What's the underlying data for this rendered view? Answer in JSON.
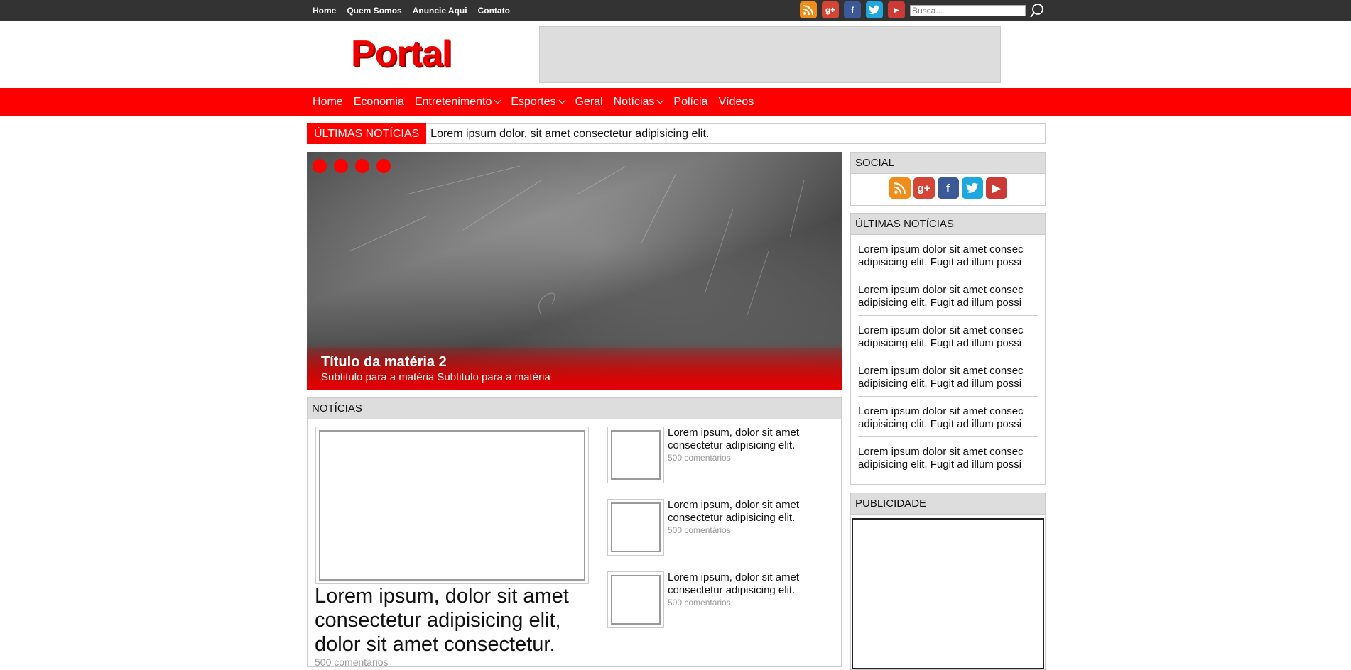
{
  "topnav": [
    "Home",
    "Quem Somos",
    "Anuncie Aqui",
    "Contato"
  ],
  "search": {
    "placeholder": "Busca..."
  },
  "social_icons": [
    "rss-icon",
    "google-plus-icon",
    "facebook-icon",
    "twitter-icon",
    "youtube-icon"
  ],
  "logo": "Portal",
  "mainnav": [
    {
      "label": "Home",
      "has_dropdown": false
    },
    {
      "label": "Economia",
      "has_dropdown": false
    },
    {
      "label": "Entretenimento",
      "has_dropdown": true
    },
    {
      "label": "Esportes",
      "has_dropdown": true
    },
    {
      "label": "Geral",
      "has_dropdown": false
    },
    {
      "label": "Notícias",
      "has_dropdown": true
    },
    {
      "label": "Polícia",
      "has_dropdown": false
    },
    {
      "label": "Vídeos",
      "has_dropdown": false
    }
  ],
  "ticker": {
    "label": "ÚLTIMAS NOTÍCIAS",
    "text": "Lorem ipsum dolor, sit amet consectetur adipisicing elit."
  },
  "slider": {
    "title": "Título da matéria 2",
    "subtitle": "Subtitulo para a matéria Subtitulo para a matéria",
    "dot_count": 4
  },
  "news": {
    "heading": "NOTÍCIAS",
    "featured": {
      "title": "Lorem ipsum, dolor sit amet consectetur adipisicing elit, dolor sit amet consectetur.",
      "comments": "500 comentários"
    },
    "items": [
      {
        "title": "Lorem ipsum, dolor sit amet consectetur adipisicing elit.",
        "comments": "500 comentários"
      },
      {
        "title": "Lorem ipsum, dolor sit amet consectetur adipisicing elit.",
        "comments": "500 comentários"
      },
      {
        "title": "Lorem ipsum, dolor sit amet consectetur adipisicing elit.",
        "comments": "500 comentários"
      }
    ]
  },
  "sidebar": {
    "social_heading": "SOCIAL",
    "latest_heading": "ÚLTIMAS NOTÍCIAS",
    "latest": [
      {
        "line1": "Lorem ipsum dolor sit amet consec",
        "line2": "adipisicing elit. Fugit ad illum possi"
      },
      {
        "line1": "Lorem ipsum dolor sit amet consec",
        "line2": "adipisicing elit. Fugit ad illum possi"
      },
      {
        "line1": "Lorem ipsum dolor sit amet consec",
        "line2": "adipisicing elit. Fugit ad illum possi"
      },
      {
        "line1": "Lorem ipsum dolor sit amet consec",
        "line2": "adipisicing elit. Fugit ad illum possi"
      },
      {
        "line1": "Lorem ipsum dolor sit amet consec",
        "line2": "adipisicing elit. Fugit ad illum possi"
      },
      {
        "line1": "Lorem ipsum dolor sit amet consec",
        "line2": "adipisicing elit. Fugit ad illum possi"
      }
    ],
    "ad_heading": "PUBLICIDADE"
  },
  "colors": {
    "accent": "#ff0000",
    "topbar": "#333333",
    "box_header": "#dddddd"
  }
}
